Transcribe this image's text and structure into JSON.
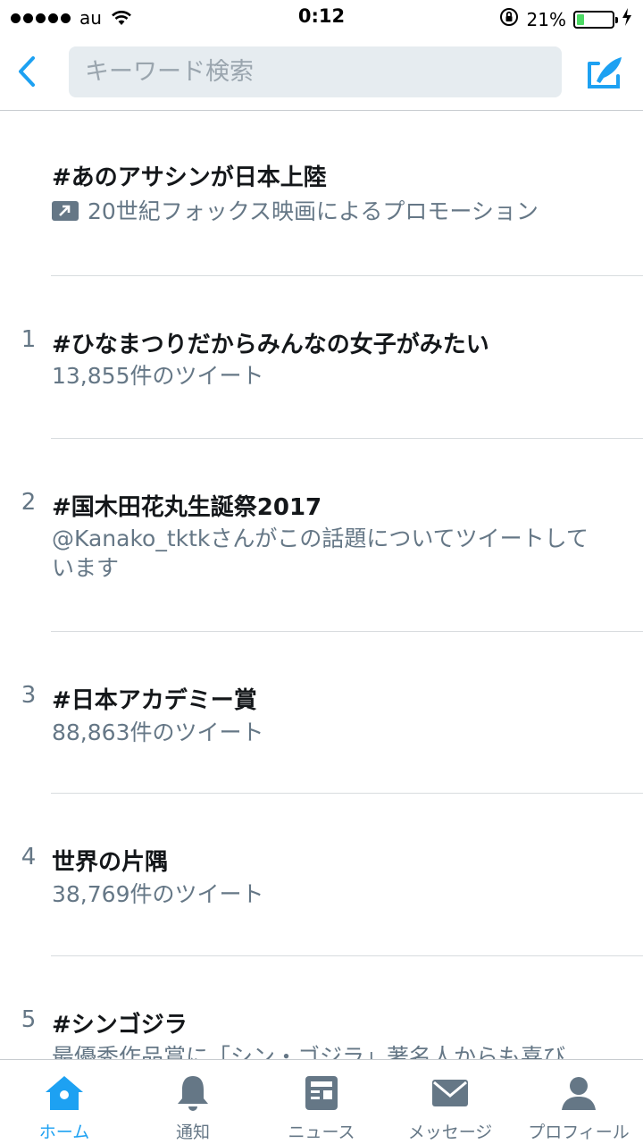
{
  "status_bar": {
    "carrier": "au",
    "time": "0:12",
    "battery_percent": "21%",
    "battery_level": 0.21,
    "battery_color": "#4cd964"
  },
  "nav": {
    "back_icon": "chevron-left-icon",
    "search_placeholder": "キーワード検索",
    "compose_icon": "compose-icon",
    "accent_color": "#1da1f2"
  },
  "trends": [
    {
      "rank": "",
      "title": "#あのアサシンが日本上陸",
      "subtitle": "20世紀フォックス映画によるプロモーション",
      "promoted": true
    },
    {
      "rank": "1",
      "title": "#ひなまつりだからみんなの女子がみたい",
      "subtitle": "13,855件のツイート",
      "promoted": false
    },
    {
      "rank": "2",
      "title": "#国木田花丸生誕祭2017",
      "subtitle": "@Kanako_tktkさんがこの話題についてツイートしています",
      "promoted": false
    },
    {
      "rank": "3",
      "title": "#日本アカデミー賞",
      "subtitle": "88,863件のツイート",
      "promoted": false
    },
    {
      "rank": "4",
      "title": "世界の片隅",
      "subtitle": "38,769件のツイート",
      "promoted": false
    },
    {
      "rank": "5",
      "title": "#シンゴジラ",
      "subtitle": "最優秀作品賞に「シン・ゴジラ」著名人からも喜び",
      "promoted": false
    }
  ],
  "tab_bar": {
    "tabs": [
      {
        "label": "ホーム",
        "icon": "home-icon",
        "active": true
      },
      {
        "label": "通知",
        "icon": "bell-icon",
        "active": false
      },
      {
        "label": "ニュース",
        "icon": "news-icon",
        "active": false
      },
      {
        "label": "メッセージ",
        "icon": "envelope-icon",
        "active": false
      },
      {
        "label": "プロフィール",
        "icon": "person-icon",
        "active": false
      }
    ]
  }
}
